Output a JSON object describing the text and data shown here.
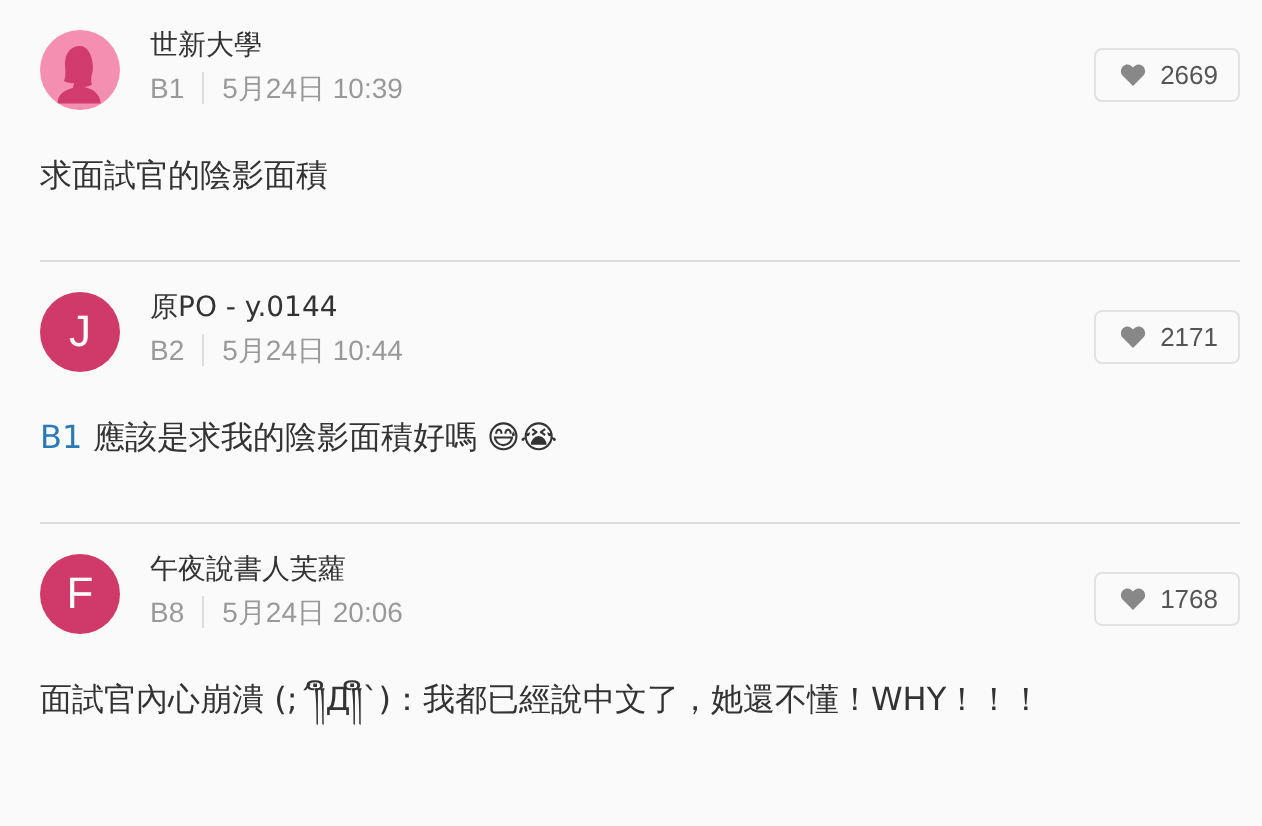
{
  "comments": [
    {
      "avatar": {
        "kind": "silhouette",
        "color": "#f48fb1"
      },
      "author": "世新大學",
      "floor": "B1",
      "time": "5月24日 10:39",
      "likes": "2669",
      "text": "求面試官的陰影面積"
    },
    {
      "avatar": {
        "kind": "letter",
        "letter": "J",
        "color": "#d03a6b"
      },
      "author": "原PO - y.0144",
      "floor": "B2",
      "time": "5月24日 10:44",
      "likes": "2171",
      "mention": "B1",
      "text": "應該是求我的陰影面積好嗎 😅😭"
    },
    {
      "avatar": {
        "kind": "letter",
        "letter": "F",
        "color": "#d03a6b"
      },
      "author": "午夜說書人芙蘿",
      "floor": "B8",
      "time": "5月24日 20:06",
      "likes": "1768",
      "text": "面試官內心崩潰 (;´༎ຶД༎ຶ`)：我都已經說中文了，她還不懂！WHY！！！"
    }
  ]
}
